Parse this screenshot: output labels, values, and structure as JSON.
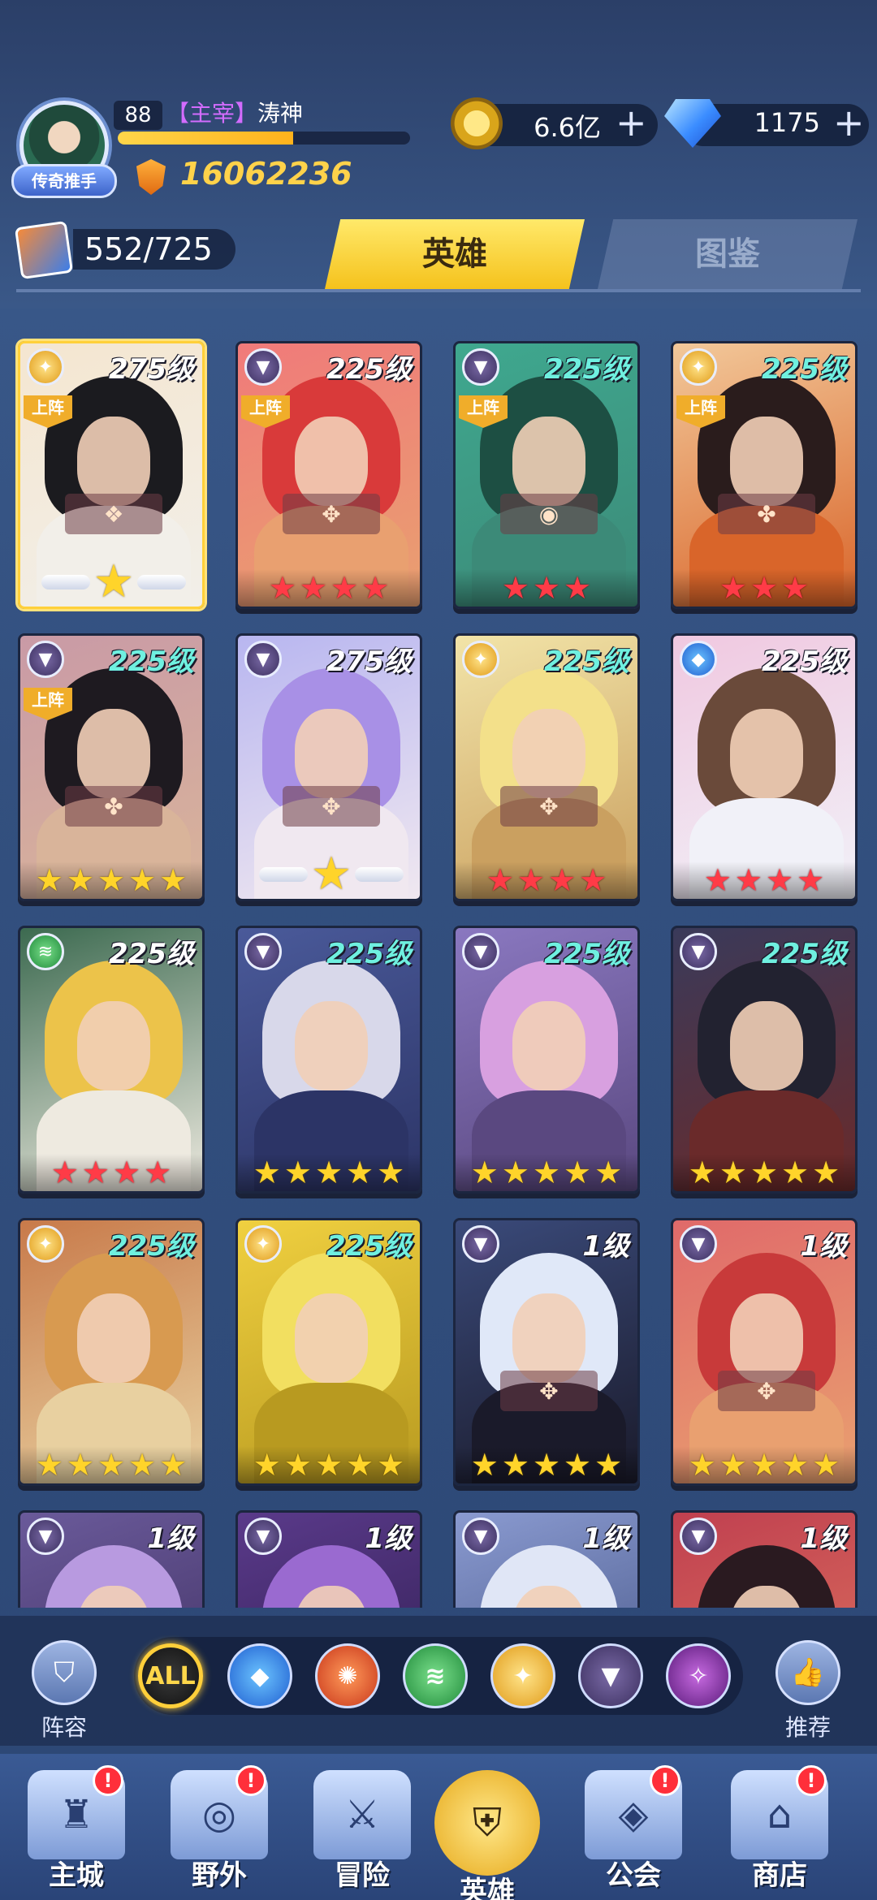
{
  "player": {
    "avatar_badge": "传奇推手",
    "level": "88",
    "title_tag": "【主宰】",
    "name": "涛神",
    "exp_progress": 0.6,
    "power": "16062236"
  },
  "currency": {
    "gold": "6.6亿",
    "gems": "1175",
    "plus_symbol": "+"
  },
  "card_count": "552/725",
  "tabs": [
    {
      "label": "英雄",
      "active": true
    },
    {
      "label": "图鉴",
      "active": false
    }
  ],
  "deploy_label": "上阵",
  "heroes": [
    {
      "faction": "light",
      "level": "275级",
      "level_color": "white",
      "deployed": true,
      "emblem": "❖",
      "star_type": "wing",
      "selected": true,
      "palette": [
        "#f4e6d0",
        "#1b1b1f",
        "#f2efe9"
      ]
    },
    {
      "faction": "dark",
      "level": "225级",
      "level_color": "white",
      "deployed": true,
      "emblem": "✥",
      "star_type": "red",
      "stars": 4,
      "palette": [
        "#f07a7a",
        "#d93a3a",
        "#e9a070"
      ]
    },
    {
      "faction": "dark",
      "level": "225级",
      "level_color": "green",
      "deployed": true,
      "emblem": "◉",
      "star_type": "red",
      "stars": 3,
      "palette": [
        "#3fa88f",
        "#1d4f43",
        "#3c8a78"
      ]
    },
    {
      "faction": "light",
      "level": "225级",
      "level_color": "green",
      "deployed": true,
      "emblem": "✤",
      "star_type": "red",
      "stars": 3,
      "palette": [
        "#f2c89a",
        "#2a1c1c",
        "#d9652a"
      ]
    },
    {
      "faction": "dark",
      "level": "225级",
      "level_color": "green",
      "deployed": true,
      "emblem": "✤",
      "star_type": "gold",
      "stars": 5,
      "palette": [
        "#c99aa6",
        "#1e1a20",
        "#d9b49a"
      ]
    },
    {
      "faction": "dark",
      "level": "275级",
      "level_color": "white",
      "deployed": false,
      "emblem": "✥",
      "star_type": "wing",
      "palette": [
        "#b8b6f0",
        "#a890e6",
        "#f0e8f0"
      ]
    },
    {
      "faction": "light",
      "level": "225级",
      "level_color": "green",
      "deployed": false,
      "emblem": "✥",
      "star_type": "red",
      "stars": 4,
      "palette": [
        "#f2e4a8",
        "#f3e08a",
        "#caa060"
      ]
    },
    {
      "faction": "water",
      "level": "225级",
      "level_color": "white",
      "deployed": false,
      "emblem": "",
      "star_type": "red",
      "stars": 4,
      "palette": [
        "#f0c8e0",
        "#6a4a3a",
        "#f1f1f8"
      ]
    },
    {
      "faction": "wind",
      "level": "225级",
      "level_color": "white",
      "deployed": false,
      "emblem": "",
      "star_type": "red",
      "stars": 4,
      "palette": [
        "#3c6a50",
        "#ecc34a",
        "#eeeae0"
      ]
    },
    {
      "faction": "dark",
      "level": "225级",
      "level_color": "green",
      "deployed": false,
      "emblem": "",
      "star_type": "gold",
      "stars": 5,
      "palette": [
        "#4a5a9a",
        "#d8d8ea",
        "#2c3466"
      ]
    },
    {
      "faction": "dark",
      "level": "225级",
      "level_color": "green",
      "deployed": false,
      "emblem": "",
      "star_type": "gold",
      "stars": 5,
      "palette": [
        "#8a78c0",
        "#d8a0e0",
        "#5a4880"
      ]
    },
    {
      "faction": "dark",
      "level": "225级",
      "level_color": "green",
      "deployed": false,
      "emblem": "",
      "star_type": "gold",
      "stars": 5,
      "palette": [
        "#3a3a5a",
        "#222230",
        "#6a2a2a"
      ]
    },
    {
      "faction": "light",
      "level": "225级",
      "level_color": "green",
      "deployed": false,
      "emblem": "",
      "star_type": "gold",
      "stars": 5,
      "palette": [
        "#c87a4a",
        "#d89a50",
        "#e8d0a0"
      ]
    },
    {
      "faction": "light",
      "level": "225级",
      "level_color": "green",
      "deployed": false,
      "emblem": "",
      "star_type": "gold",
      "stars": 5,
      "palette": [
        "#f0d040",
        "#f2df60",
        "#b89a20"
      ]
    },
    {
      "faction": "dark",
      "level": "1级",
      "level_color": "white",
      "deployed": false,
      "emblem": "✥",
      "star_type": "gold",
      "stars": 5,
      "palette": [
        "#3a4a7a",
        "#e0e8f8",
        "#1a1a2a"
      ]
    },
    {
      "faction": "dark",
      "level": "1级",
      "level_color": "white",
      "deployed": false,
      "emblem": "✥",
      "star_type": "gold",
      "stars": 5,
      "palette": [
        "#e06a6a",
        "#c83a3a",
        "#e9a070"
      ]
    },
    {
      "faction": "dark",
      "level": "1级",
      "level_color": "white",
      "deployed": false,
      "emblem": "",
      "star_type": "none",
      "palette": [
        "#6a5a9a",
        "#b89ae0",
        "#3a2a5a"
      ]
    },
    {
      "faction": "dark",
      "level": "1级",
      "level_color": "white",
      "deployed": false,
      "emblem": "",
      "star_type": "none",
      "palette": [
        "#5a3a8a",
        "#9a6ad0",
        "#2a1a4a"
      ]
    },
    {
      "faction": "dark",
      "level": "1级",
      "level_color": "white",
      "deployed": false,
      "emblem": "",
      "star_type": "none",
      "palette": [
        "#8a9ad0",
        "#e0e6f6",
        "#3a4a7a"
      ]
    },
    {
      "faction": "dark",
      "level": "1级",
      "level_color": "white",
      "deployed": false,
      "emblem": "",
      "star_type": "none",
      "palette": [
        "#c04050",
        "#2a1a20",
        "#e07a60"
      ]
    }
  ],
  "filter": {
    "lineup_label": "阵容",
    "recommend_label": "推荐",
    "buttons": [
      {
        "key": "all",
        "label": "ALL",
        "active": true
      },
      {
        "key": "water",
        "label": "◆"
      },
      {
        "key": "fire",
        "label": "✺"
      },
      {
        "key": "wind",
        "label": "≋"
      },
      {
        "key": "light",
        "label": "✦"
      },
      {
        "key": "dark",
        "label": "▼"
      },
      {
        "key": "void",
        "label": "✧"
      }
    ]
  },
  "nav": [
    {
      "key": "city",
      "label": "主城",
      "badge": "!",
      "icon": "castle-icon",
      "glyph": "♜"
    },
    {
      "key": "wild",
      "label": "野外",
      "badge": "!",
      "icon": "portal-icon",
      "glyph": "◎"
    },
    {
      "key": "adventure",
      "label": "冒险",
      "badge": "",
      "icon": "sword-icon",
      "glyph": "⚔"
    },
    {
      "key": "hero",
      "label": "英雄",
      "badge": "",
      "icon": "helmet-icon",
      "glyph": "⛨",
      "active": true
    },
    {
      "key": "guild",
      "label": "公会",
      "badge": "!",
      "icon": "banner-icon",
      "glyph": "◈"
    },
    {
      "key": "shop",
      "label": "商店",
      "badge": "!",
      "icon": "shop-icon",
      "glyph": "⌂"
    }
  ]
}
